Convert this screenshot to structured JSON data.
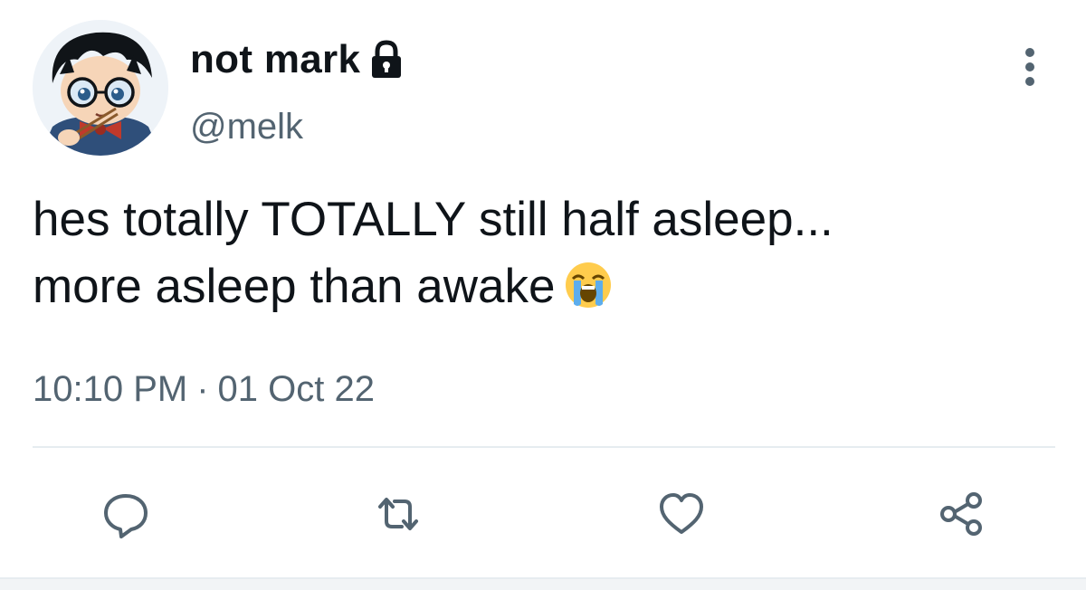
{
  "author": {
    "display_name": "not mark",
    "handle": "@melk",
    "protected_icon": "lock-icon",
    "avatar_icon": "anime-boy-avatar"
  },
  "tweet": {
    "text_line1": "hes totally TOTALLY still half asleep...",
    "text_line2": "more asleep than awake",
    "emoji": "loudly-crying-face",
    "time": "10:10 PM",
    "separator": "·",
    "date": "01 Oct 22"
  },
  "actions": {
    "more": "more-options-icon",
    "reply": "reply-icon",
    "retweet": "retweet-icon",
    "like": "heart-icon",
    "share": "share-icon"
  },
  "colors": {
    "text": "#0f1419",
    "secondary": "#536471",
    "icon": "#536471",
    "divider": "#e6ecf0"
  }
}
